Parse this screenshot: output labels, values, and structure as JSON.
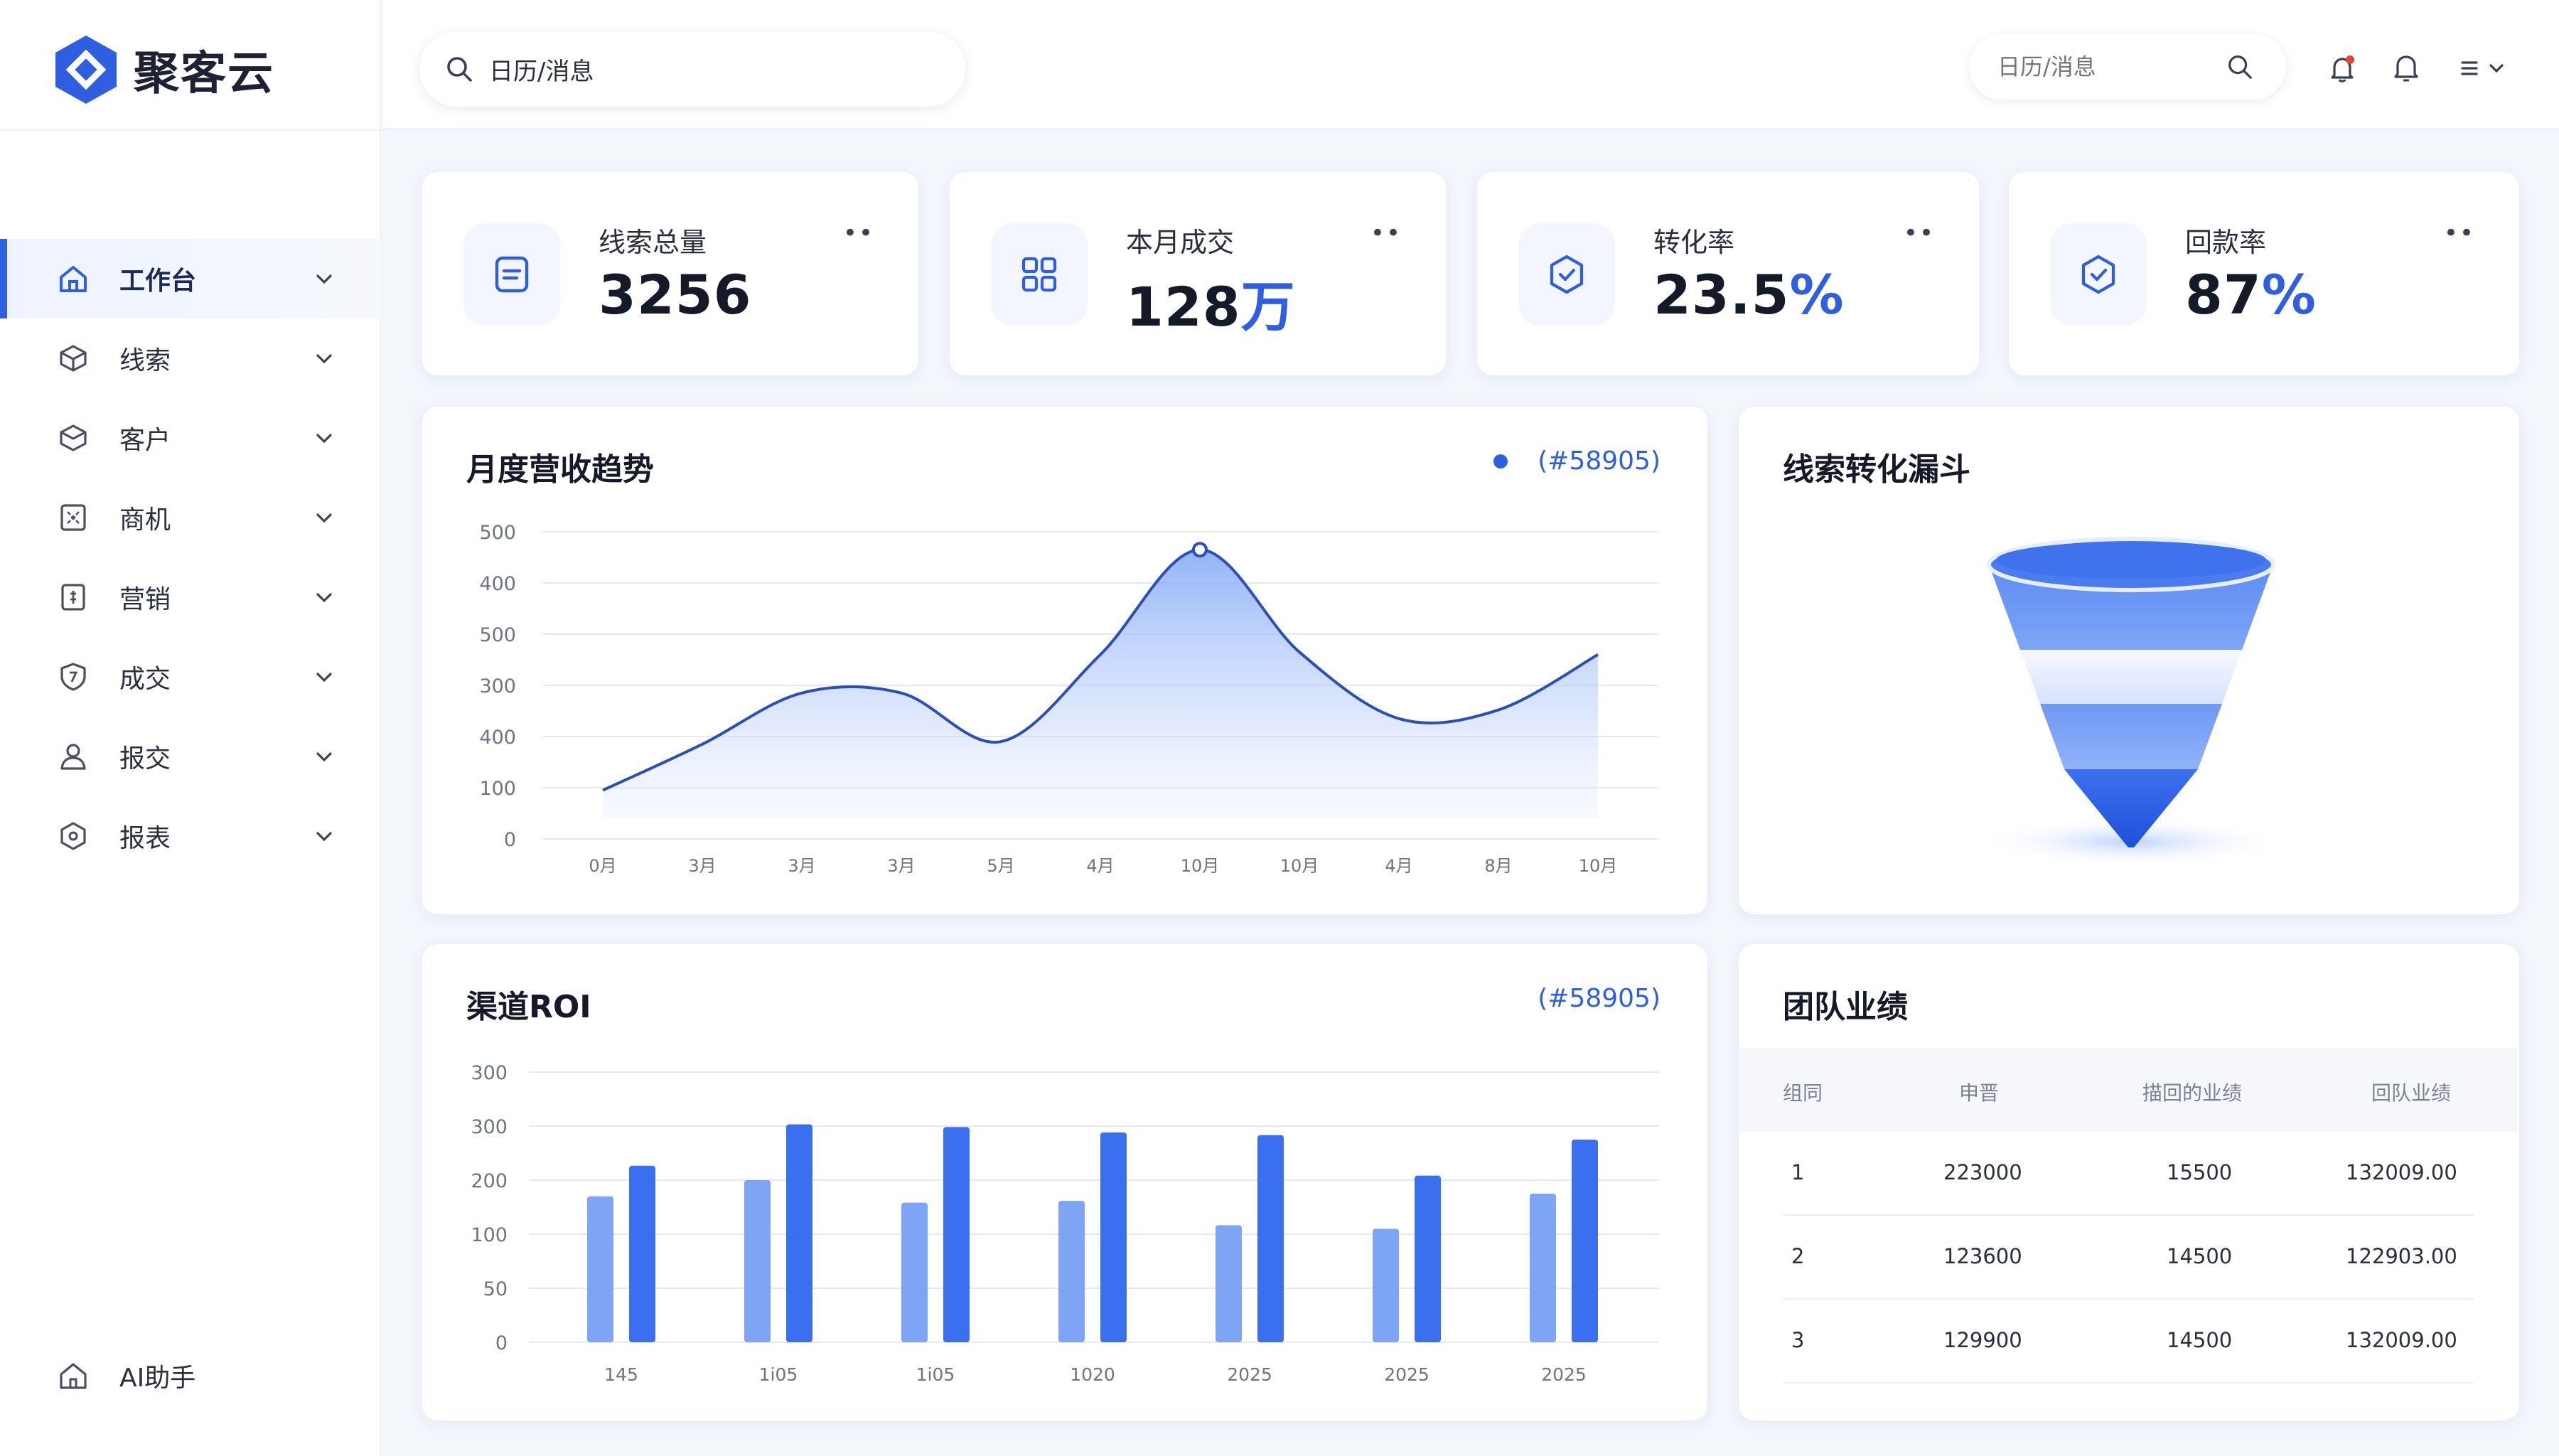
{
  "app": {
    "name": "聚客云"
  },
  "sidebar": {
    "items": [
      {
        "label": "工作台",
        "active": true
      },
      {
        "label": "线索"
      },
      {
        "label": "客户"
      },
      {
        "label": "商机"
      },
      {
        "label": "营销"
      },
      {
        "label": "成交"
      },
      {
        "label": "报交"
      },
      {
        "label": "报表"
      }
    ],
    "ai_label": "AI助手"
  },
  "topbar": {
    "search_main_value": "日历/消息",
    "search_right_placeholder": "日历/消息"
  },
  "stats": [
    {
      "label": "线索总量",
      "value": "3256",
      "unit": "",
      "more": "••"
    },
    {
      "label": "本月成交",
      "value": "128",
      "unit": "万",
      "more": "••"
    },
    {
      "label": "转化率",
      "value": "23.5",
      "unit": "%",
      "more": "••"
    },
    {
      "label": "回款率",
      "value": "87",
      "unit": "%",
      "more": "••"
    }
  ],
  "revenue": {
    "title": "月度营收趋势",
    "legend": "(#58905)"
  },
  "funnel": {
    "title": "线索转化漏斗",
    "colors": [
      "#4a7cf0",
      "#e3ecff",
      "#7aa2f6",
      "#2e62e6"
    ]
  },
  "roi": {
    "title": "渠道ROI",
    "legend": "(#58905)"
  },
  "team": {
    "title": "团队业绩",
    "headers": [
      "组同",
      "申晋",
      "描回的业绩",
      "回队业绩"
    ],
    "rows": [
      [
        "1",
        "223000",
        "15500",
        "132009.00"
      ],
      [
        "2",
        "123600",
        "14500",
        "122903.00"
      ],
      [
        "3",
        "129900",
        "14500",
        "132009.00"
      ]
    ]
  },
  "colors": {
    "accent": "#2f5fe0",
    "bar_light": "#7ea4f5",
    "bar_dark": "#3a6ff0",
    "area": "#8fb2f8"
  },
  "chart_data": [
    {
      "type": "area",
      "title": "月度营收趋势",
      "legend": "(#58905)",
      "y_ticks": [
        "500",
        "400",
        "500",
        "300",
        "400",
        "100",
        "0"
      ],
      "categories": [
        "0月",
        "3月",
        "3月",
        "3月",
        "5月",
        "4月",
        "10月",
        "10月",
        "4月",
        "8月",
        "10月"
      ],
      "values": [
        95,
        185,
        285,
        285,
        190,
        360,
        565,
        365,
        235,
        252,
        360
      ],
      "ylim": [
        0,
        600
      ],
      "highlight_index": 6,
      "grid": true
    },
    {
      "type": "bar",
      "title": "渠道ROI",
      "legend": "(#58905)",
      "y_ticks": [
        "300",
        "300",
        "200",
        "100",
        "50",
        "0"
      ],
      "categories": [
        "145",
        "1i05",
        "1i05",
        "1020",
        "2025",
        "2025",
        "2025"
      ],
      "series": [
        {
          "values": [
            162,
            180,
            155,
            157,
            130,
            126,
            165
          ]
        },
        {
          "values": [
            196,
            242,
            239,
            233,
            230,
            185,
            225
          ]
        }
      ],
      "ylim": [
        0,
        300
      ],
      "grid": true
    }
  ]
}
